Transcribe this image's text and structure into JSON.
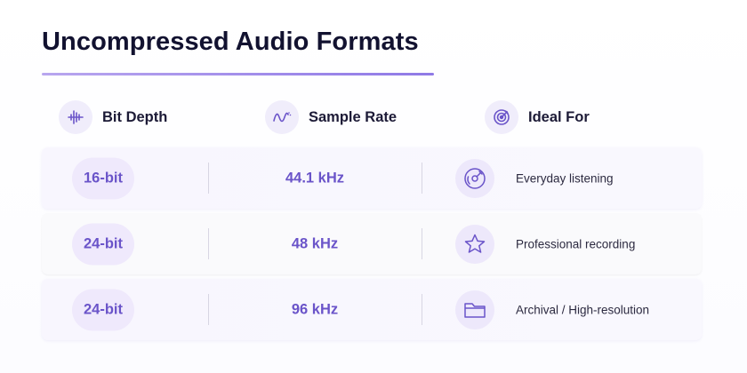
{
  "title": "Uncompressed Audio Formats",
  "headers": [
    {
      "label": "Bit Depth",
      "icon": "waveform-bars-icon"
    },
    {
      "label": "Sample Rate",
      "icon": "sine-wave-icon"
    },
    {
      "label": "Ideal For",
      "icon": "target-icon"
    }
  ],
  "rows": [
    {
      "bit_depth": "16-bit",
      "sample_rate": "44.1 kHz",
      "ideal_for": "Everyday listening",
      "icon": "disc-icon"
    },
    {
      "bit_depth": "24-bit",
      "sample_rate": "48 kHz",
      "ideal_for": "Professional recording",
      "icon": "star-icon"
    },
    {
      "bit_depth": "24-bit",
      "sample_rate": "96 kHz",
      "ideal_for": "Archival / High-resolution",
      "icon": "folder-icon"
    }
  ],
  "colors": {
    "accent": "#6a54c9",
    "pill_bg": "#efe9fc",
    "title": "#121230",
    "underline": "#a893eb"
  }
}
